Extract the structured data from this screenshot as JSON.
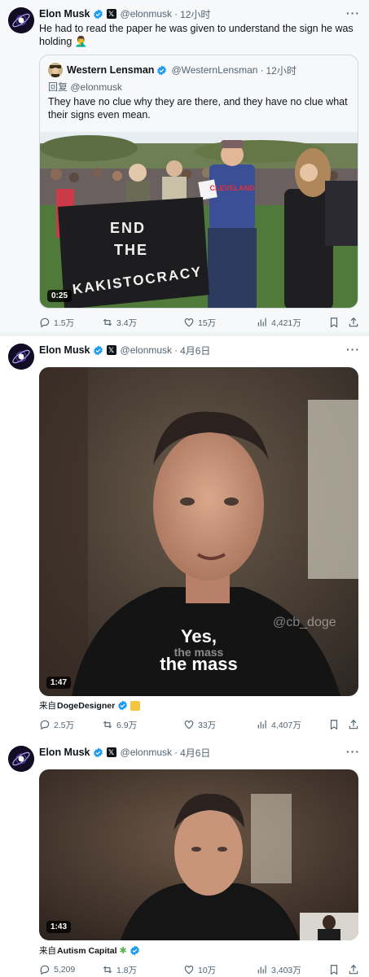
{
  "tweets": [
    {
      "author": "Elon Musk",
      "handle": "@elonmusk",
      "time": "12小时",
      "text": "He had to read the paper he was given to understand the sign he was holding 🤦‍♂️",
      "quote": {
        "author": "Western Lensman",
        "handle": "@WesternLensman",
        "time": "12小时",
        "reply_prefix": "回复",
        "reply_to": "@elonmusk",
        "text": "They have no clue why they are there, and they have no clue what their signs even mean.",
        "sign_lines": [
          "END",
          "THE",
          "KAKISTOCRACY"
        ],
        "shirt_text": "CLEVELAND",
        "duration": "0:25"
      },
      "stats": {
        "replies": "1.5万",
        "reposts": "3.4万",
        "likes": "15万",
        "views": "4,421万"
      }
    },
    {
      "author": "Elon Musk",
      "handle": "@elonmusk",
      "time": "4月6日",
      "video": {
        "duration": "1:47",
        "caption_top": "Yes,",
        "caption_ghost": "the mass",
        "caption_main": "the mass",
        "watermark": "@cb_doge"
      },
      "from_prefix": "来自",
      "from_name": "DogeDesigner",
      "stats": {
        "replies": "2.5万",
        "reposts": "6.9万",
        "likes": "33万",
        "views": "4,407万"
      }
    },
    {
      "author": "Elon Musk",
      "handle": "@elonmusk",
      "time": "4月6日",
      "video": {
        "duration": "1:43"
      },
      "from_prefix": "来自",
      "from_name": "Autism Capital",
      "stats": {
        "replies": "5,209",
        "reposts": "1.8万",
        "likes": "10万",
        "views": "3,403万"
      }
    }
  ],
  "colors": {
    "verified": "#1d9bf0",
    "text_secondary": "#536471",
    "border": "#cfd9de"
  },
  "icons": [
    "more-icon",
    "verified-icon",
    "x-badge-icon",
    "reply-icon",
    "repost-icon",
    "like-icon",
    "views-icon",
    "bookmark-icon",
    "share-icon"
  ]
}
